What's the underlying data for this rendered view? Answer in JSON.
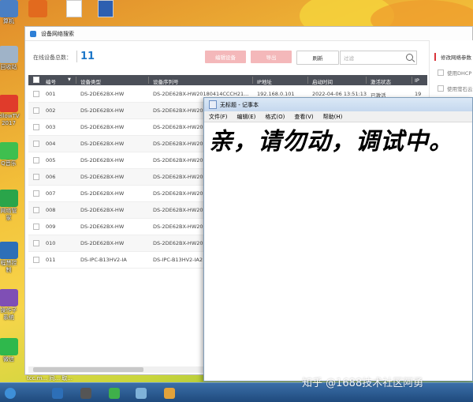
{
  "desktop": {
    "icons": [
      {
        "label": "算机",
        "color": "#4a7fc4"
      },
      {
        "label": "回收站",
        "color": "#9fb3c8"
      },
      {
        "label": "ellowTV\n2017",
        "color": "#e03b2b"
      },
      {
        "label": "Q音乐",
        "color": "#3fbf4f"
      },
      {
        "label": "网络管\n家",
        "color": "#2aa54a"
      },
      {
        "label": "程慧控\n制",
        "color": "#2d6fb8"
      },
      {
        "label": "操作子\n系统",
        "color": "#7f4fb5"
      },
      {
        "label": "微信",
        "color": "#2fb84c"
      }
    ],
    "top_icons": [
      {
        "label": "",
        "color": "#e26a1e"
      },
      {
        "label": "",
        "color": "#ffffff"
      },
      {
        "label": "",
        "color": "#2d5fb0"
      }
    ],
    "bottom_partial": "tcc.m... 间... 取..."
  },
  "device_window": {
    "title": "设备网络搜索",
    "count_label": "在线设备总数：",
    "count_value": "11",
    "buttons": {
      "modify": "编辑设备",
      "export": "导出",
      "refresh": "刷新"
    },
    "filter_placeholder": "过滤",
    "side_panel": {
      "title": "修改网络参数",
      "options": [
        "使用DHCP",
        "使用萤石云"
      ]
    },
    "columns": [
      "编号",
      "设备类型",
      "设备序列号",
      "IP地址",
      "启动时间",
      "激活状态",
      "IP"
    ],
    "rows": [
      {
        "id": "001",
        "type": "DS-2DE62BX-HW",
        "serial": "DS-2DE62BX-HW20180414CCCH21...",
        "ip": "192.168.0.101",
        "time": "2022-04-06 13:51:13",
        "status": "已激活",
        "ipv": "19"
      },
      {
        "id": "002",
        "type": "DS-2DE62BX-HW",
        "serial": "DS-2DE62BX-HW20",
        "ip": "",
        "time": "",
        "status": "",
        "ipv": ""
      },
      {
        "id": "003",
        "type": "DS-2DE62BX-HW",
        "serial": "DS-2DE62BX-HW20",
        "ip": "",
        "time": "",
        "status": "",
        "ipv": ""
      },
      {
        "id": "004",
        "type": "DS-2DE62BX-HW",
        "serial": "DS-2DE62BX-HW20",
        "ip": "",
        "time": "",
        "status": "",
        "ipv": ""
      },
      {
        "id": "005",
        "type": "DS-2DE62BX-HW",
        "serial": "DS-2DE62BX-HW20",
        "ip": "",
        "time": "",
        "status": "",
        "ipv": ""
      },
      {
        "id": "006",
        "type": "DS-2DE62BX-HW",
        "serial": "DS-2DE62BX-HW20",
        "ip": "",
        "time": "",
        "status": "",
        "ipv": ""
      },
      {
        "id": "007",
        "type": "DS-2DE62BX-HW",
        "serial": "DS-2DE62BX-HW20",
        "ip": "",
        "time": "",
        "status": "",
        "ipv": ""
      },
      {
        "id": "008",
        "type": "DS-2DE62BX-HW",
        "serial": "DS-2DE62BX-HW20",
        "ip": "",
        "time": "",
        "status": "",
        "ipv": ""
      },
      {
        "id": "009",
        "type": "DS-2DE62BX-HW",
        "serial": "DS-2DE62BX-HW20",
        "ip": "",
        "time": "",
        "status": "",
        "ipv": ""
      },
      {
        "id": "010",
        "type": "DS-2DE62BX-HW",
        "serial": "DS-2DE62BX-HW20",
        "ip": "",
        "time": "",
        "status": "",
        "ipv": ""
      },
      {
        "id": "011",
        "type": "DS-IPC-B13HV2-IA",
        "serial": "DS-IPC-B13HV2-IA2",
        "ip": "",
        "time": "",
        "status": "",
        "ipv": ""
      }
    ]
  },
  "notepad": {
    "title": "无标题 - 记事本",
    "menu": [
      "文件(F)",
      "编辑(E)",
      "格式(O)",
      "查看(V)",
      "帮助(H)"
    ],
    "content": "亲，请勿动，调试中。"
  },
  "taskbar": {
    "items": [
      {
        "icon": "start-orb",
        "color": "#3e8fd8"
      },
      {
        "icon": "app-icon",
        "color": "#2d6fb8"
      },
      {
        "icon": "media-icon",
        "color": "#555555"
      },
      {
        "icon": "browser-icon",
        "color": "#3fb04a"
      },
      {
        "icon": "folder-icon",
        "color": "#7fb2d9"
      },
      {
        "icon": "search-tool-icon",
        "color": "#e3a23a"
      }
    ]
  },
  "watermark": "知乎 @1688技术社区阿勇"
}
